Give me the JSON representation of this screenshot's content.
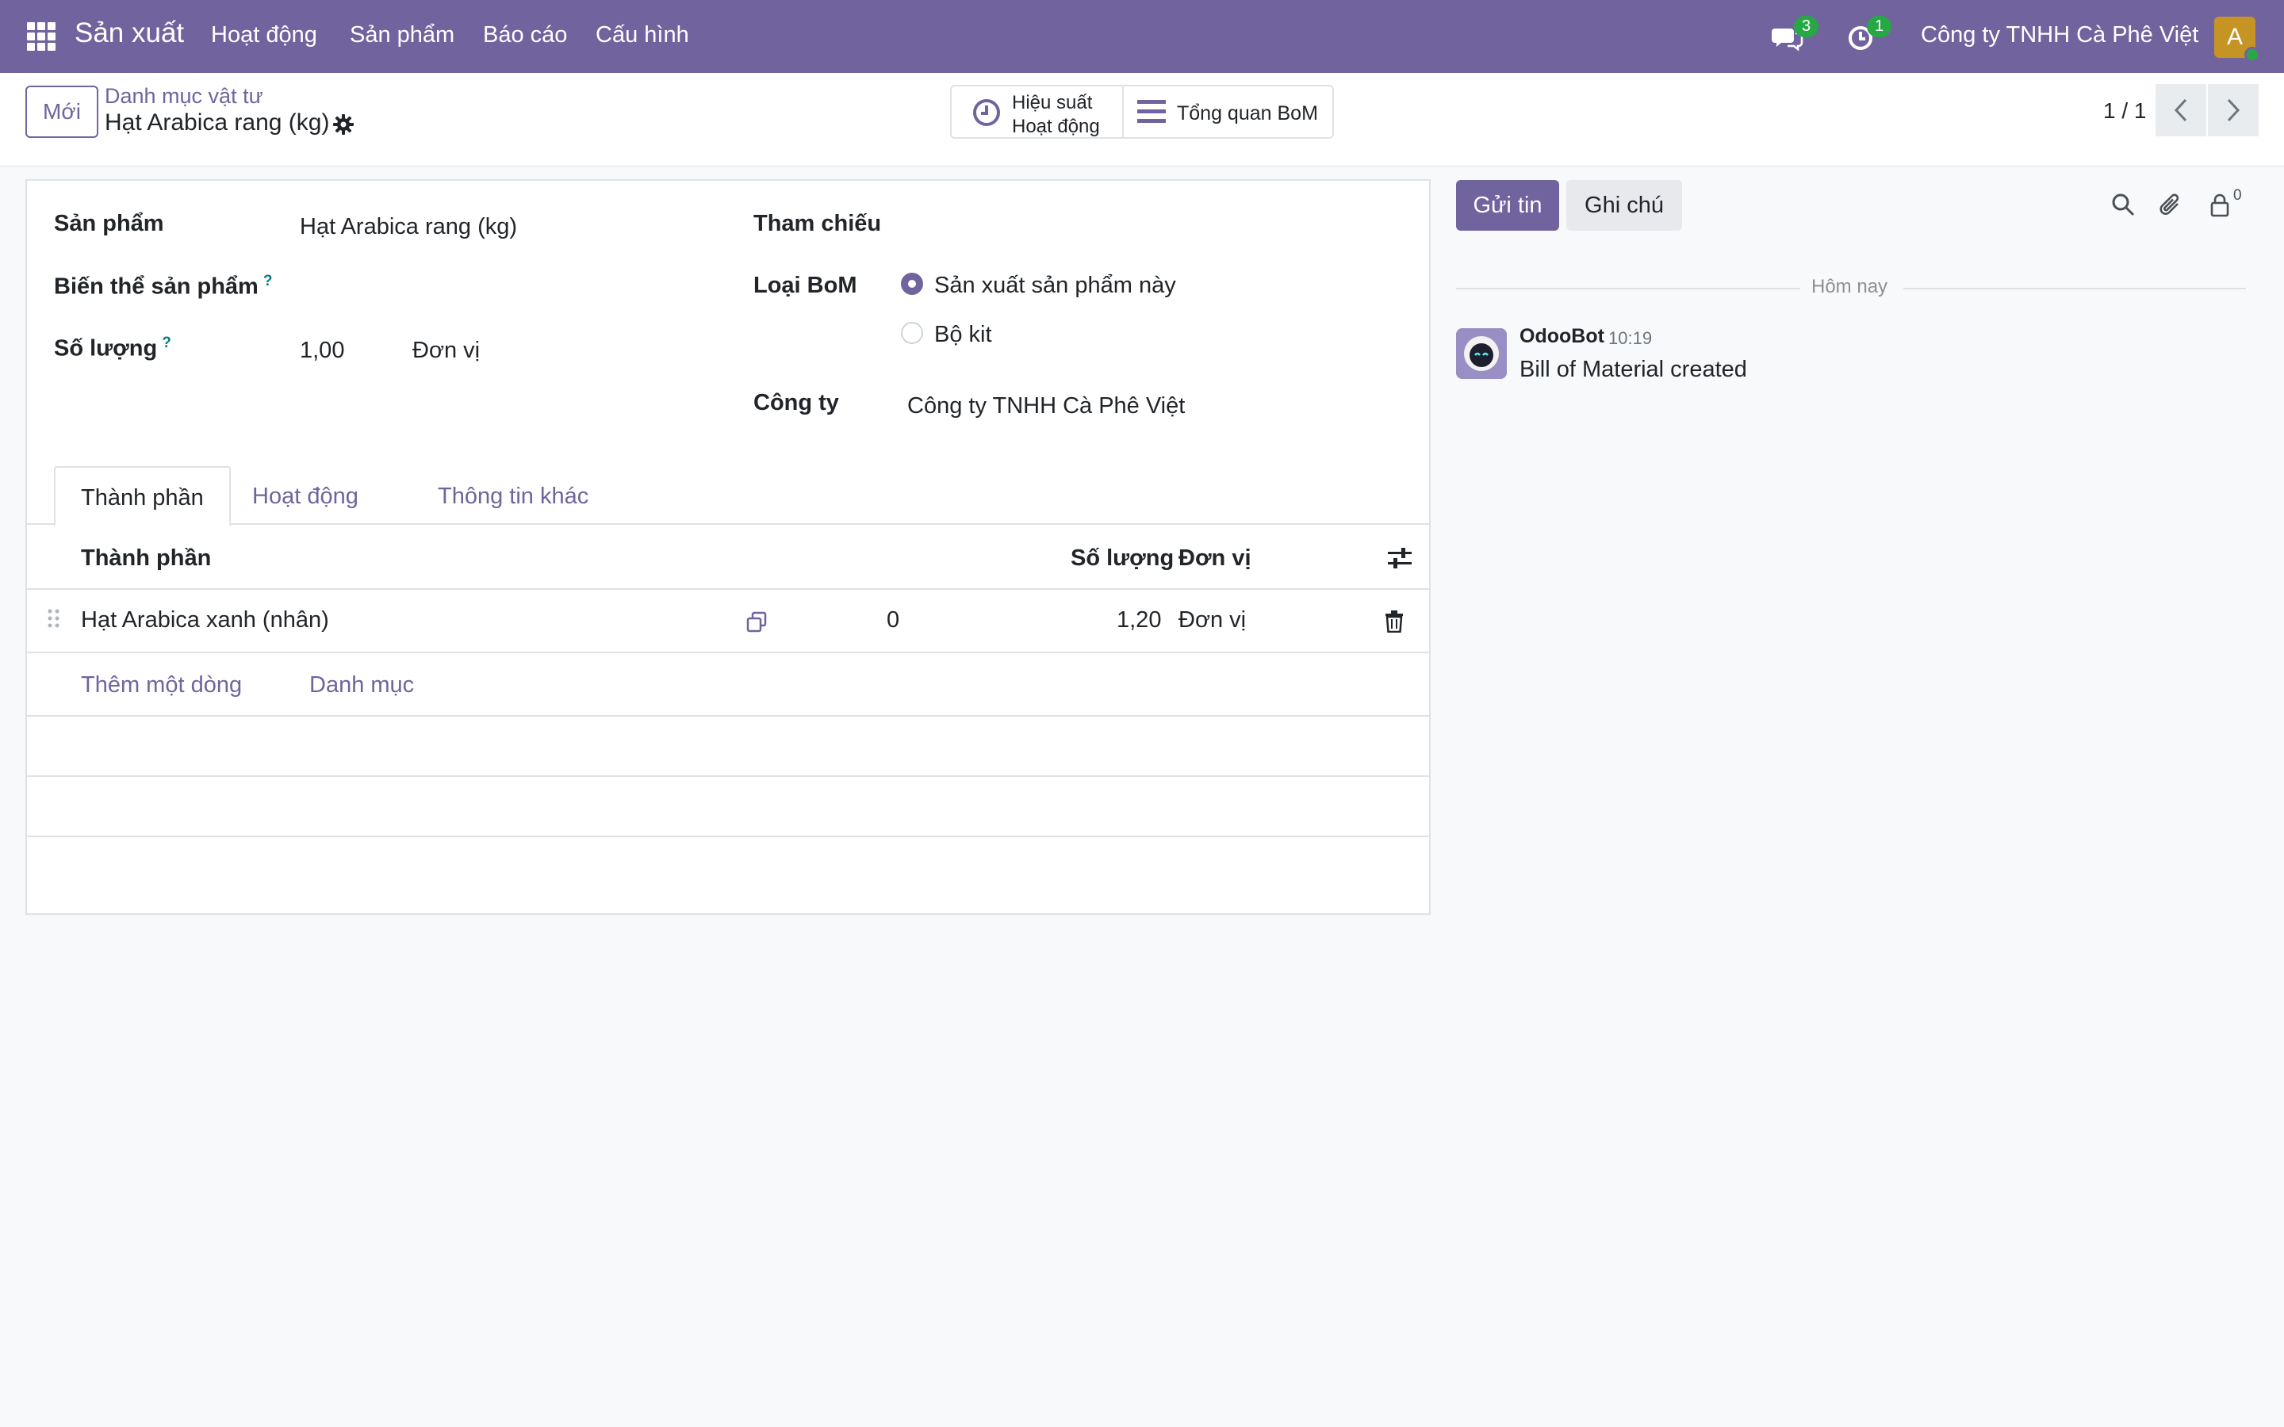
{
  "topnav": {
    "app_name": "Sản xuất",
    "menu": [
      "Hoạt động",
      "Sản phẩm",
      "Báo cáo",
      "Cấu hình"
    ],
    "messages_count": "3",
    "activities_count": "1",
    "company": "Công ty TNHH Cà Phê Việt",
    "avatar_letter": "A",
    "icons": [
      "apps-grid-icon",
      "chat-bubbles-icon",
      "clock-icon"
    ]
  },
  "control_panel": {
    "new_button": "Mới",
    "breadcrumb_parent": "Danh mục vật tư",
    "breadcrumb_current": "Hạt Arabica rang (kg)",
    "smart_buttons": {
      "efficiency_line1": "Hiệu suất",
      "efficiency_line2": "Hoạt động",
      "overview": "Tổng quan BoM"
    },
    "pager": "1 / 1"
  },
  "form": {
    "product_label": "Sản phẩm",
    "product_value": "Hạt Arabica rang (kg)",
    "variant_label": "Biến thể sản phẩm",
    "quantity_label": "Số lượng",
    "quantity_value": "1,00",
    "quantity_uom": "Đơn vị",
    "reference_label": "Tham chiếu",
    "bom_type_label": "Loại BoM",
    "bom_type_options": [
      "Sản xuất sản phẩm này",
      "Bộ kit"
    ],
    "bom_type_selected": "Sản xuất sản phẩm này",
    "company_label": "Công ty",
    "company_value": "Công ty TNHH Cà Phê Việt",
    "help_mark": "?"
  },
  "tabs": [
    "Thành phần",
    "Hoạt động",
    "Thông tin khác"
  ],
  "components_table": {
    "headers": [
      "Thành phần",
      "Số lượng",
      "Đơn vị"
    ],
    "rows": [
      {
        "component": "Hạt Arabica xanh (nhân)",
        "availability": "0",
        "quantity": "1,20",
        "uom": "Đơn vị"
      }
    ],
    "add_line": "Thêm một dòng",
    "catalog": "Danh mục"
  },
  "chatter": {
    "send_message": "Gửi tin",
    "log_note": "Ghi chú",
    "followers_count": "0",
    "date_separator": "Hôm nay",
    "messages": [
      {
        "author": "OdooBot",
        "time": "10:19",
        "body": "Bill of Material created"
      }
    ]
  },
  "colors": {
    "brand": "#71639e",
    "badge": "#28a745",
    "link": "#71639e",
    "help": "#017e84"
  }
}
